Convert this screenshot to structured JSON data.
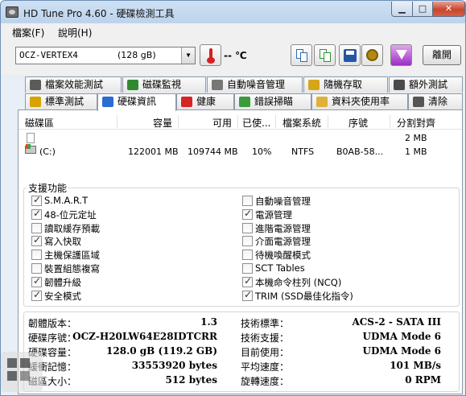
{
  "window": {
    "title": "HD Tune Pro 4.60 - 硬碟檢測工具",
    "min_glyph": "▁",
    "max_glyph": "□",
    "close_glyph": "✕"
  },
  "menu": {
    "file": "檔案(F)",
    "help": "說明(H)"
  },
  "toolbar": {
    "drive_model": "OCZ-VERTEX4",
    "drive_size": "(128 gB)",
    "temperature": "-- ℃",
    "exit_label": "離開"
  },
  "tabs_row1": [
    {
      "label": "檔案效能測試",
      "icon": "file-benchmark-icon",
      "color": "#5b5b5b"
    },
    {
      "label": "磁碟監視",
      "icon": "disk-monitor-icon",
      "color": "#2f8a2f"
    },
    {
      "label": "自動噪音管理",
      "icon": "speaker-icon",
      "color": "#777777"
    },
    {
      "label": "隨機存取",
      "icon": "random-access-icon",
      "color": "#d7a51a"
    },
    {
      "label": "額外測試",
      "icon": "extra-tests-icon",
      "color": "#4a4a4a"
    }
  ],
  "tabs_row2": [
    {
      "label": "標準測試",
      "icon": "benchmark-icon",
      "color": "#d6a300"
    },
    {
      "label": "硬碟資訊",
      "icon": "info-icon",
      "color": "#2a6bd4"
    },
    {
      "label": "健康",
      "icon": "health-cross-icon",
      "color": "#d72424"
    },
    {
      "label": "錯誤掃瞄",
      "icon": "error-scan-icon",
      "color": "#3b9a3b"
    },
    {
      "label": "資料夾使用率",
      "icon": "folder-icon",
      "color": "#e0b13a"
    },
    {
      "label": "清除",
      "icon": "erase-trash-icon",
      "color": "#555555"
    }
  ],
  "partitions": {
    "columns": [
      "磁碟區",
      "容量",
      "可用",
      "已使...",
      "檔案系統",
      "序號",
      "分割對齊"
    ],
    "rows": [
      {
        "volume": "",
        "capacity": "",
        "free": "",
        "used": "",
        "fs": "",
        "serial": "",
        "align": "2 MB"
      },
      {
        "volume": "(C:)",
        "capacity": "122001 MB",
        "free": "109744 MB",
        "used": "10%",
        "fs": "NTFS",
        "serial": "B0AB-58...",
        "align": "1 MB"
      }
    ]
  },
  "features": {
    "title": "支援功能",
    "left": [
      {
        "label": "S.M.A.R.T",
        "checked": true
      },
      {
        "label": "48-位元定址",
        "checked": true
      },
      {
        "label": "讀取緩存預載",
        "checked": false
      },
      {
        "label": "寫入快取",
        "checked": true
      },
      {
        "label": "主機保護區域",
        "checked": false
      },
      {
        "label": "裝置組態複寫",
        "checked": false
      },
      {
        "label": "韌體升級",
        "checked": true
      },
      {
        "label": "安全模式",
        "checked": true
      }
    ],
    "right": [
      {
        "label": "自動噪音管理",
        "checked": false
      },
      {
        "label": "電源管理",
        "checked": true
      },
      {
        "label": "進階電源管理",
        "checked": false
      },
      {
        "label": "介面電源管理",
        "checked": false
      },
      {
        "label": "待機喚醒模式",
        "checked": false
      },
      {
        "label": "SCT Tables",
        "checked": false
      },
      {
        "label": "本機命令柱列 (NCQ)",
        "checked": true
      },
      {
        "label": "TRIM (SSD最佳化指令)",
        "checked": true
      }
    ]
  },
  "info": {
    "left": [
      {
        "label": "韌體版本：",
        "value": "1.3"
      },
      {
        "label": "硬碟序號：",
        "value": "OCZ-H20LW64E28IDTCRR"
      },
      {
        "label": "硬碟容量：",
        "value": "128.0 gB (119.2 GB)"
      },
      {
        "label": "緩衝記憶：",
        "value": "33553920 bytes"
      },
      {
        "label": "磁區大小：",
        "value": "512 bytes"
      }
    ],
    "right": [
      {
        "label": "技術標準：",
        "value": "ACS-2 - SATA III"
      },
      {
        "label": "技術支援：",
        "value": "UDMA Mode 6"
      },
      {
        "label": "目前使用：",
        "value": "UDMA Mode 6"
      },
      {
        "label": "平均速度：",
        "value": "101 MB/s"
      },
      {
        "label": "旋轉速度：",
        "value": "0 RPM"
      }
    ]
  }
}
